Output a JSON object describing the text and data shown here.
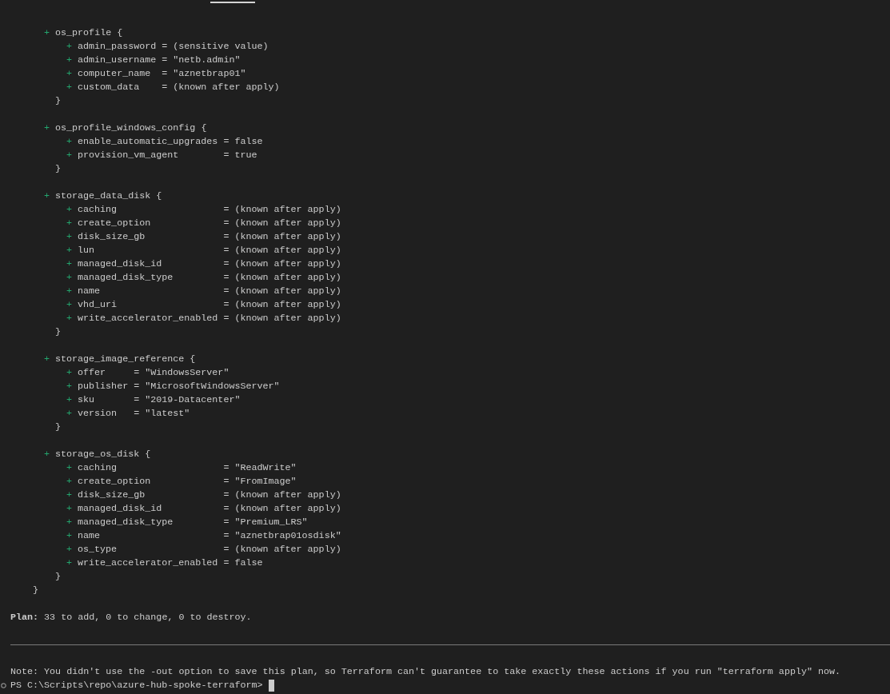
{
  "resource": {
    "blocks": [
      {
        "marker": "+",
        "header": "os_profile {",
        "attributes": [
          {
            "marker": "+",
            "text": "admin_password = (sensitive value)"
          },
          {
            "marker": "+",
            "text": "admin_username = \"netb.admin\""
          },
          {
            "marker": "+",
            "text": "computer_name  = \"aznetbrap01\""
          },
          {
            "marker": "+",
            "text": "custom_data    = (known after apply)"
          }
        ],
        "close": "}"
      },
      {
        "marker": "+",
        "header": "os_profile_windows_config {",
        "attributes": [
          {
            "marker": "+",
            "text": "enable_automatic_upgrades = false"
          },
          {
            "marker": "+",
            "text": "provision_vm_agent        = true"
          }
        ],
        "close": "}"
      },
      {
        "marker": "+",
        "header": "storage_data_disk {",
        "attributes": [
          {
            "marker": "+",
            "text": "caching                   = (known after apply)"
          },
          {
            "marker": "+",
            "text": "create_option             = (known after apply)"
          },
          {
            "marker": "+",
            "text": "disk_size_gb              = (known after apply)"
          },
          {
            "marker": "+",
            "text": "lun                       = (known after apply)"
          },
          {
            "marker": "+",
            "text": "managed_disk_id           = (known after apply)"
          },
          {
            "marker": "+",
            "text": "managed_disk_type         = (known after apply)"
          },
          {
            "marker": "+",
            "text": "name                      = (known after apply)"
          },
          {
            "marker": "+",
            "text": "vhd_uri                   = (known after apply)"
          },
          {
            "marker": "+",
            "text": "write_accelerator_enabled = (known after apply)"
          }
        ],
        "close": "}"
      },
      {
        "marker": "+",
        "header": "storage_image_reference {",
        "attributes": [
          {
            "marker": "+",
            "text": "offer     = \"WindowsServer\""
          },
          {
            "marker": "+",
            "text": "publisher = \"MicrosoftWindowsServer\""
          },
          {
            "marker": "+",
            "text": "sku       = \"2019-Datacenter\""
          },
          {
            "marker": "+",
            "text": "version   = \"latest\""
          }
        ],
        "close": "}"
      },
      {
        "marker": "+",
        "header": "storage_os_disk {",
        "attributes": [
          {
            "marker": "+",
            "text": "caching                   = \"ReadWrite\""
          },
          {
            "marker": "+",
            "text": "create_option             = \"FromImage\""
          },
          {
            "marker": "+",
            "text": "disk_size_gb              = (known after apply)"
          },
          {
            "marker": "+",
            "text": "managed_disk_id           = (known after apply)"
          },
          {
            "marker": "+",
            "text": "managed_disk_type         = \"Premium_LRS\""
          },
          {
            "marker": "+",
            "text": "name                      = \"aznetbrap01osdisk\""
          },
          {
            "marker": "+",
            "text": "os_type                   = (known after apply)"
          },
          {
            "marker": "+",
            "text": "write_accelerator_enabled = false"
          }
        ],
        "close": "}"
      }
    ],
    "close": "}"
  },
  "plan": "**Plan:** 33 to add, 0 to change, 0 to destroy.",
  "note": "Note: You didn't use the -out option to save this plan, so Terraform can't guarantee to take exactly these actions if you run \"terraform apply\" now.",
  "prompt": "PS C:\\Scripts\\repo\\azure-hub-spoke-terraform>"
}
